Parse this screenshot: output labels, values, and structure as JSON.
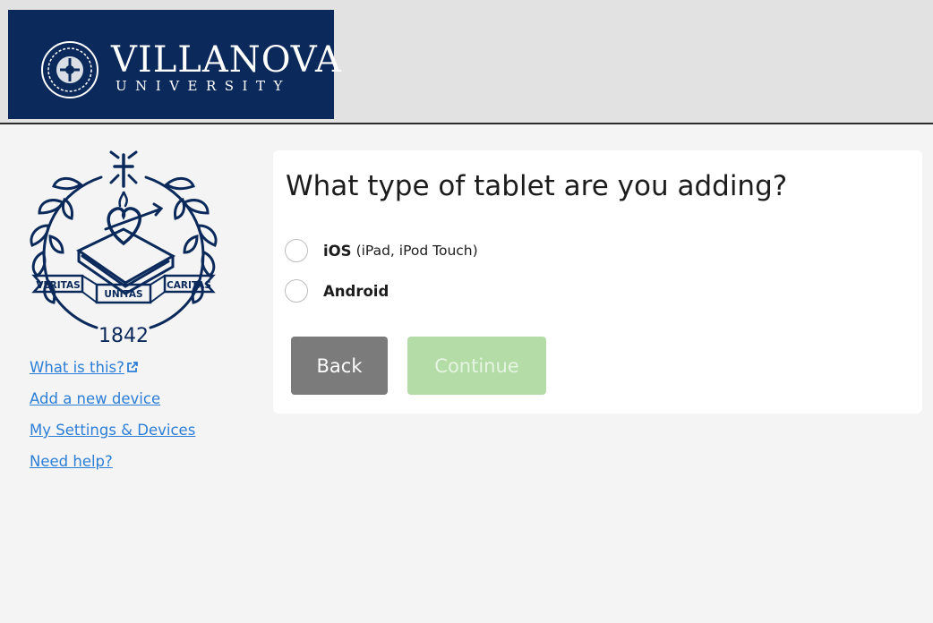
{
  "header": {
    "title": "VILLANOVA",
    "subtitle": "UNIVERSITY",
    "header_bg": "#e2e2e2",
    "banner_color": "#0b2a5b"
  },
  "logo": {
    "motto_left": "VERITAS",
    "motto_center": "UNITAS",
    "motto_right": "CARITAS",
    "year": "1842",
    "color": "#0b2a5b"
  },
  "sidebar": {
    "links": [
      {
        "label": "What is this?",
        "icon": "external-link-icon"
      },
      {
        "label": "Add a new device"
      },
      {
        "label": "My Settings & Devices"
      },
      {
        "label": "Need help?"
      }
    ],
    "link_color": "#2c7ed6"
  },
  "main": {
    "question": "What type of tablet are you adding?",
    "options": [
      {
        "label": "iOS",
        "detail": "(iPad, iPod Touch)",
        "selected": false
      },
      {
        "label": "Android",
        "detail": "",
        "selected": false
      }
    ],
    "buttons": {
      "back": "Back",
      "continue": "Continue",
      "continue_enabled": false
    },
    "colors": {
      "back": "#7b7b7b",
      "continue_disabled": "#b3dca7"
    }
  }
}
